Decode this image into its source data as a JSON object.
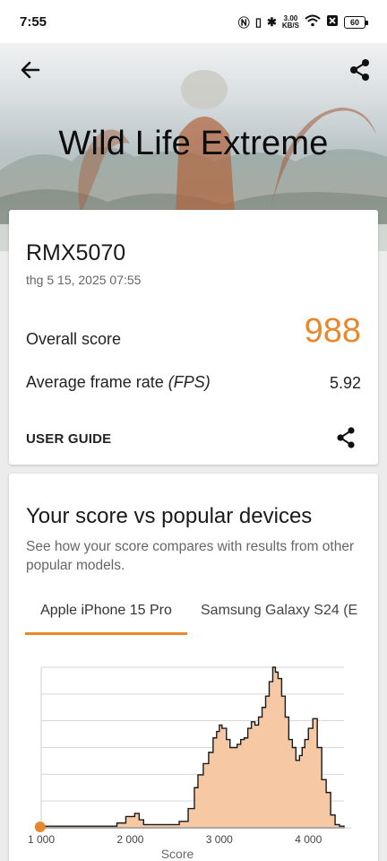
{
  "status_bar": {
    "time": "7:55",
    "net_speed_value": "3.00",
    "net_speed_unit": "KB/S",
    "battery": "60"
  },
  "header": {
    "title": "Wild Life Extreme",
    "back_icon": "arrow-left-icon",
    "share_icon": "share-icon"
  },
  "result": {
    "device": "RMX5070",
    "date": "thg 5 15, 2025 07:55",
    "overall_label": "Overall score",
    "overall_value": "988",
    "fps_label": "Average frame rate ",
    "fps_unit": "(FPS)",
    "fps_value": "5.92",
    "user_guide": "USER GUIDE"
  },
  "compare": {
    "title": "Your score vs popular devices",
    "subtitle": "See how your score compares with results from other popular models.",
    "tabs": [
      "Apple iPhone 15 Pro",
      "Samsung Galaxy S24 (E"
    ],
    "active_tab": 0
  },
  "colors": {
    "accent": "#e8882e",
    "histogram_fill": "#f7c8a4",
    "histogram_stroke": "#1a1a1a"
  },
  "chart_data": {
    "type": "area",
    "xlabel": "Score",
    "ylabel": "",
    "xticks": [
      "1 000",
      "2 000",
      "3 000",
      "4 000"
    ],
    "xlim": [
      1000,
      4400
    ],
    "ylim": [
      0,
      1
    ],
    "grid": true,
    "marker": {
      "name": "Your score",
      "x": 988
    },
    "series": [
      {
        "x": [
          1000,
          1200,
          1600,
          1850,
          1950,
          2050,
          2100,
          2150,
          2300,
          2550,
          2650,
          2720,
          2760,
          2820,
          2880,
          2930,
          2970,
          3000,
          3030,
          3080,
          3120,
          3160,
          3200,
          3240,
          3280,
          3320,
          3360,
          3400,
          3440,
          3480,
          3520,
          3560,
          3600,
          3630,
          3660,
          3700,
          3740,
          3780,
          3820,
          3860,
          3900,
          3930,
          3960,
          4000,
          4050,
          4100,
          4150,
          4200,
          4250,
          4300,
          4350
        ],
        "values": [
          0.01,
          0.01,
          0.01,
          0.03,
          0.07,
          0.09,
          0.05,
          0.02,
          0.02,
          0.04,
          0.12,
          0.25,
          0.33,
          0.4,
          0.47,
          0.56,
          0.6,
          0.64,
          0.62,
          0.55,
          0.5,
          0.5,
          0.52,
          0.55,
          0.56,
          0.62,
          0.66,
          0.64,
          0.69,
          0.75,
          0.82,
          0.91,
          1.0,
          0.97,
          0.93,
          0.82,
          0.69,
          0.55,
          0.5,
          0.42,
          0.45,
          0.5,
          0.55,
          0.62,
          0.68,
          0.5,
          0.3,
          0.22,
          0.08,
          0.02,
          0.01
        ]
      }
    ]
  }
}
